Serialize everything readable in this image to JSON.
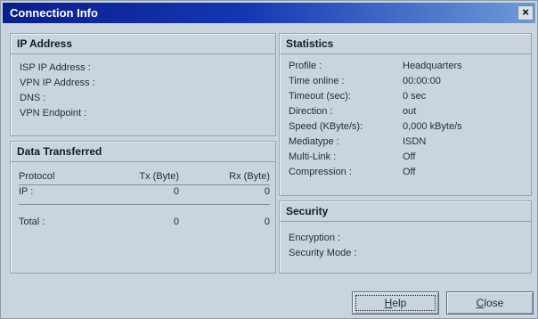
{
  "window": {
    "title": "Connection Info",
    "close_glyph": "×"
  },
  "ip_address": {
    "header": "IP Address",
    "rows": [
      {
        "label": "ISP IP Address :",
        "value": ""
      },
      {
        "label": "VPN IP Address :",
        "value": ""
      },
      {
        "label": "DNS :",
        "value": ""
      },
      {
        "label": "VPN Endpoint :",
        "value": ""
      }
    ]
  },
  "data_transferred": {
    "header": "Data Transferred",
    "columns": [
      "Protocol",
      "Tx (Byte)",
      "Rx (Byte)"
    ],
    "rows": [
      {
        "protocol": "IP :",
        "tx": "0",
        "rx": "0"
      }
    ],
    "total": {
      "label": "Total :",
      "tx": "0",
      "rx": "0"
    }
  },
  "statistics": {
    "header": "Statistics",
    "rows": [
      {
        "label": "Profile :",
        "value": "Headquarters"
      },
      {
        "label": "Time online :",
        "value": "00:00:00"
      },
      {
        "label": "Timeout (sec):",
        "value": "0  sec"
      },
      {
        "label": "Direction :",
        "value": "out"
      },
      {
        "label": "Speed (KByte/s):",
        "value": "0,000  kByte/s"
      },
      {
        "label": "Mediatype :",
        "value": "ISDN"
      },
      {
        "label": "Multi-Link :",
        "value": "Off"
      },
      {
        "label": "Compression :",
        "value": "Off"
      }
    ]
  },
  "security": {
    "header": "Security",
    "rows": [
      {
        "label": "Encryption :",
        "value": ""
      },
      {
        "label": "Security Mode :",
        "value": ""
      }
    ]
  },
  "buttons": {
    "help": {
      "mnemonic": "H",
      "rest": "elp"
    },
    "close": {
      "mnemonic": "C",
      "rest": "lose"
    }
  }
}
